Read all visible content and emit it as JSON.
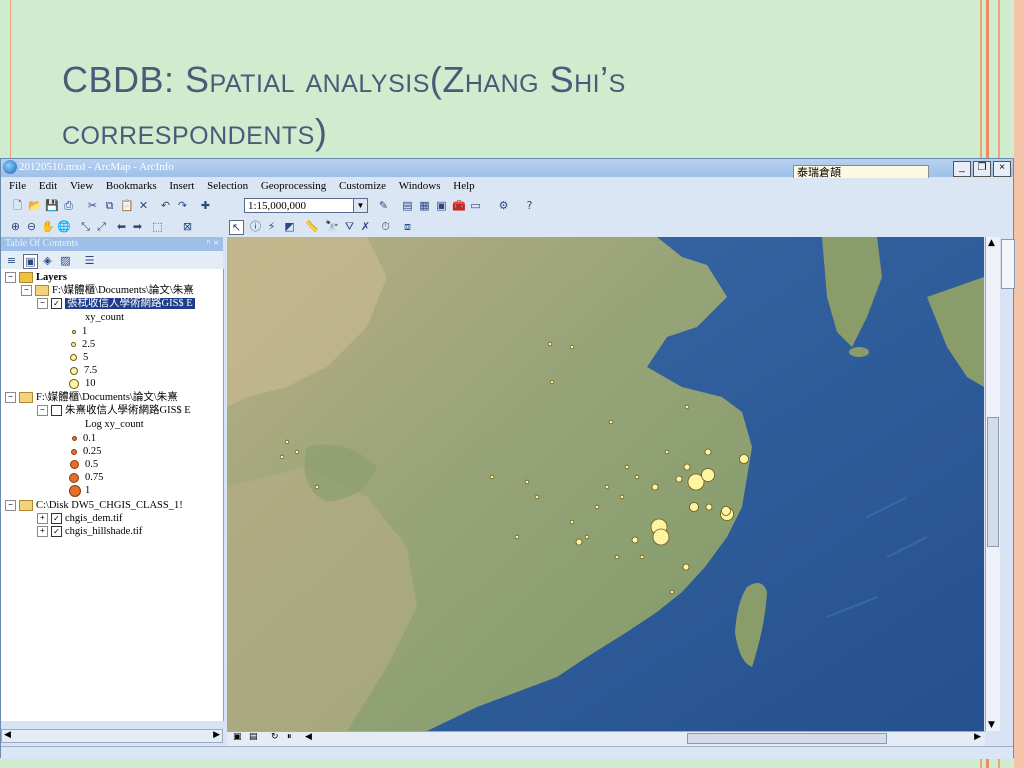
{
  "slide": {
    "title_line1": "CBDB: Spatial analysis(Zhang Shi’s",
    "title_line2": "correspondents)"
  },
  "window": {
    "title": "20120510.mxd - ArcMap - ArcInfo",
    "ime_text": "泰瑞倉頡"
  },
  "menu": [
    "File",
    "Edit",
    "View",
    "Bookmarks",
    "Insert",
    "Selection",
    "Geoprocessing",
    "Customize",
    "Windows",
    "Help"
  ],
  "toolbar": {
    "scale": "1:15,000,000"
  },
  "toc": {
    "header": "Table Of Contents",
    "root": "Layers",
    "group1_path": "F:\\媒體櫃\\Documents\\論文\\朱熹",
    "layer1_name": "張栻收信人學術網路GIS$ E",
    "layer1_field": "xy_count",
    "legend1": [
      "1",
      "2.5",
      "5",
      "7.5",
      "10"
    ],
    "group2_path": "F:\\媒體櫃\\Documents\\論文\\朱熹",
    "layer2_name": "朱熹收信人學術網路GIS$ E",
    "layer2_field": "Log xy_count",
    "legend2": [
      "0.1",
      "0.25",
      "0.5",
      "0.75",
      "1"
    ],
    "group3_path": "C:\\Disk DW5_CHGIS_CLASS_1!",
    "raster1": "chgis_dem.tif",
    "raster2": "chgis_hillshade.tif"
  },
  "colors": {
    "slide_bg": "#cfeccf",
    "title": "#4b5a78",
    "point_fill": "#fff4a0",
    "point_stroke": "#6a5a20",
    "legend2_fill": "#e0702a",
    "sea": "#2c5a96",
    "land": "#8a9c6a"
  },
  "map_points": [
    {
      "size": 10
    },
    {
      "size": 10
    },
    {
      "size": 10
    },
    {
      "size": 7.5
    },
    {
      "size": 7.5
    },
    {
      "size": 5
    },
    {
      "size": 5
    },
    {
      "size": 5
    },
    {
      "size": 2.5
    },
    {
      "size": 2.5
    },
    {
      "size": 2.5
    },
    {
      "size": 2.5
    },
    {
      "size": 2.5
    },
    {
      "size": 2.5
    },
    {
      "size": 2.5
    },
    {
      "size": 2.5
    },
    {
      "size": 1
    },
    {
      "size": 1
    },
    {
      "size": 1
    },
    {
      "size": 1
    },
    {
      "size": 1
    },
    {
      "size": 1
    },
    {
      "size": 1
    },
    {
      "size": 1
    },
    {
      "size": 1
    },
    {
      "size": 1
    },
    {
      "size": 1
    },
    {
      "size": 1
    },
    {
      "size": 1
    },
    {
      "size": 1
    },
    {
      "size": 1
    },
    {
      "size": 1
    },
    {
      "size": 1
    },
    {
      "size": 1
    },
    {
      "size": 1
    },
    {
      "size": 1
    },
    {
      "size": 1
    },
    {
      "size": 1
    },
    {
      "size": 1
    },
    {
      "size": 1
    }
  ]
}
